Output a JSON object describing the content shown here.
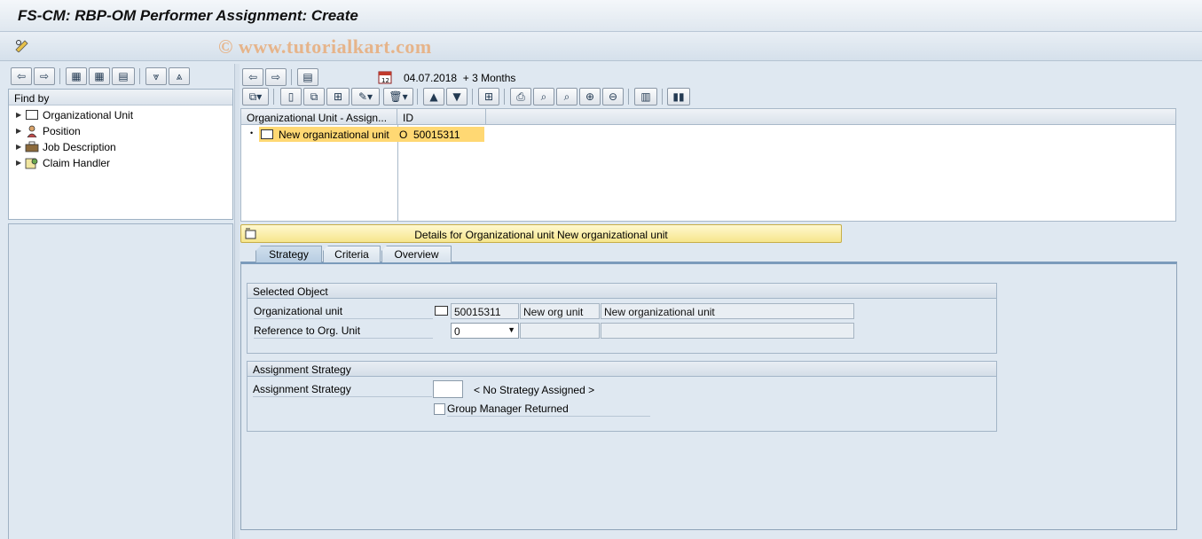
{
  "window": {
    "title": "FS-CM: RBP-OM Performer Assignment: Create",
    "watermark": "© www.tutorialkart.com"
  },
  "left_panel": {
    "find_by_label": "Find by",
    "items": [
      {
        "label": "Organizational Unit",
        "icon": "org-unit-icon"
      },
      {
        "label": "Position",
        "icon": "person-icon"
      },
      {
        "label": "Job Description",
        "icon": "job-icon"
      },
      {
        "label": "Claim Handler",
        "icon": "claim-handler-icon"
      }
    ]
  },
  "date_range": {
    "date": "04.07.2018",
    "period": "+ 3 Months"
  },
  "table": {
    "columns": [
      "Organizational Unit - Assign...",
      "ID"
    ],
    "rows": [
      {
        "name": "New organizational unit",
        "type": "O",
        "id": "50015311"
      }
    ]
  },
  "details": {
    "banner": "Details for Organizational unit New organizational unit"
  },
  "tabs": [
    "Strategy",
    "Criteria",
    "Overview"
  ],
  "selected_object": {
    "title": "Selected Object",
    "org_unit_label": "Organizational unit",
    "org_unit_id": "50015311",
    "org_unit_short": "New org unit",
    "org_unit_long": "New organizational unit",
    "reference_label": "Reference to Org. Unit",
    "reference_value": "0",
    "reference_short": "",
    "reference_long": ""
  },
  "assignment": {
    "title": "Assignment Strategy",
    "strategy_label": "Assignment Strategy",
    "strategy_value": "",
    "strategy_text": "< No Strategy Assigned >",
    "group_manager_label": "Group Manager Returned",
    "group_manager_checked": false
  },
  "colors": {
    "selection": "#ffd873",
    "banner": "#f6e68c",
    "background": "#dfe8f1"
  }
}
